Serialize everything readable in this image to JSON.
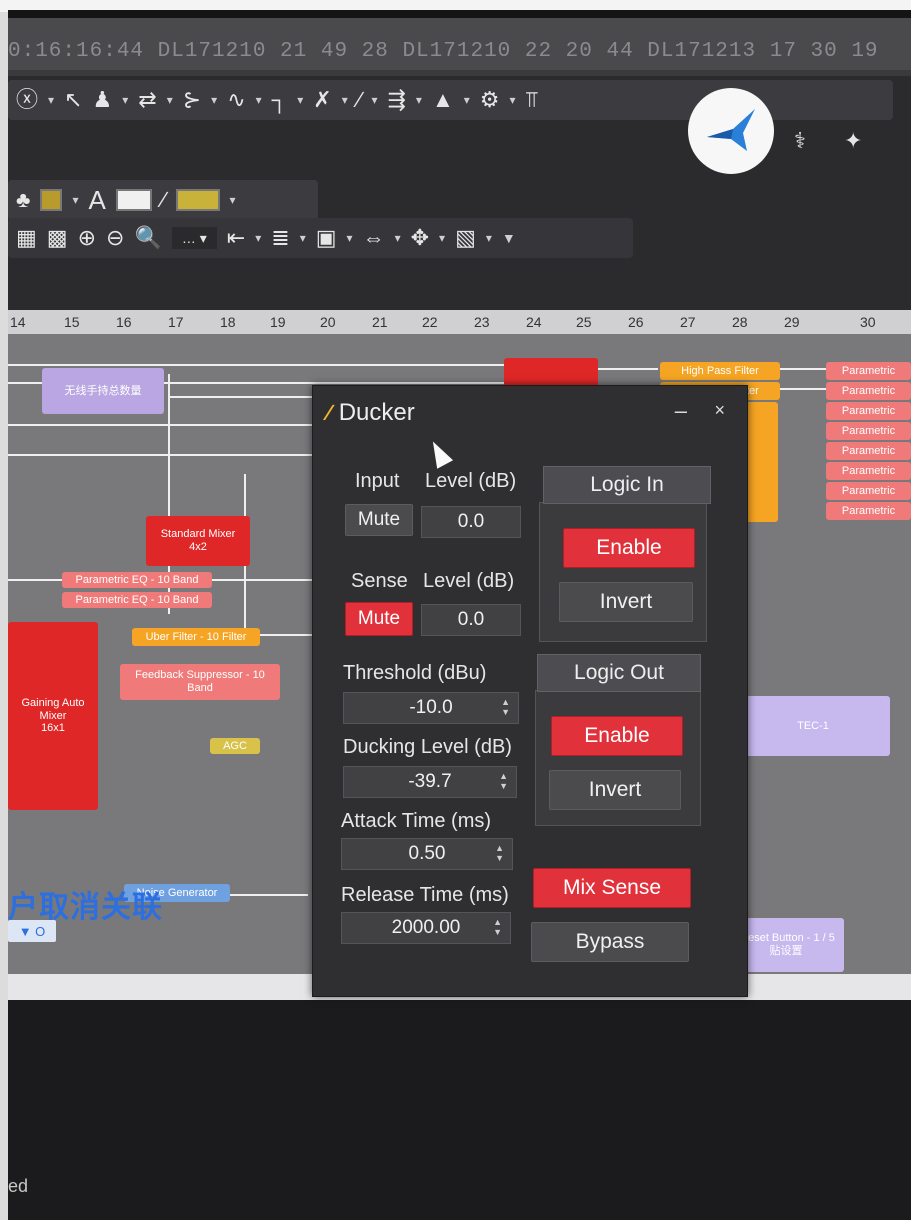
{
  "log_strip": {
    "text": "0:16:16:44  DL171210 21 49 28  DL171210 22 20 44  DL171213  17 30 19"
  },
  "ruler": {
    "ticks": [
      "14",
      "15",
      "16",
      "17",
      "18",
      "19",
      "20",
      "21",
      "22",
      "23",
      "24",
      "25",
      "26",
      "27",
      "28",
      "29",
      "30"
    ]
  },
  "canvas_blocks": {
    "wireless_count": "无线手持总数量",
    "std_mixer": "Standard Mixer\n4x2",
    "peq1": "Parametric EQ - 10 Band",
    "peq2": "Parametric EQ - 10 Band",
    "uber": "Uber Filter - 10 Filter",
    "feedback": "Feedback Suppressor - 10\nBand",
    "agc": "AGC",
    "auto_mixer": "Gaining Auto Mixer\n16x1",
    "noise": "Noise Generator",
    "hpf1": "High Pass Filter",
    "hpf2": "High Pass Filter",
    "param_label": "Parametric",
    "tec": "TEC-1",
    "preset": "Preset Button - 1 / 5\n贴设置",
    "cn_big": "户取消关联",
    "cn_small": "▼ O"
  },
  "ducker": {
    "title": "Ducker",
    "input_label": "Input",
    "input_level_label": "Level (dB)",
    "input_mute": "Mute",
    "input_level": "0.0",
    "sense_label": "Sense",
    "sense_level_label": "Level (dB)",
    "sense_mute": "Mute",
    "sense_level": "0.0",
    "threshold_label": "Threshold (dBu)",
    "threshold": "-10.0",
    "ducking_label": "Ducking Level (dB)",
    "ducking": "-39.7",
    "attack_label": "Attack Time (ms)",
    "attack": "0.50",
    "release_label": "Release Time (ms)",
    "release": "2000.00",
    "logic_in_label": "Logic In",
    "logic_in_enable": "Enable",
    "logic_in_invert": "Invert",
    "logic_out_label": "Logic Out",
    "logic_out_enable": "Enable",
    "logic_out_invert": "Invert",
    "mix_sense": "Mix Sense",
    "bypass": "Bypass",
    "minimize": "–",
    "close": "×"
  },
  "status": {
    "text": "ed"
  },
  "colors": {
    "accent_red": "#e1323c",
    "dialog_bg": "#2f2f31",
    "title_icon": "#f2b530"
  }
}
